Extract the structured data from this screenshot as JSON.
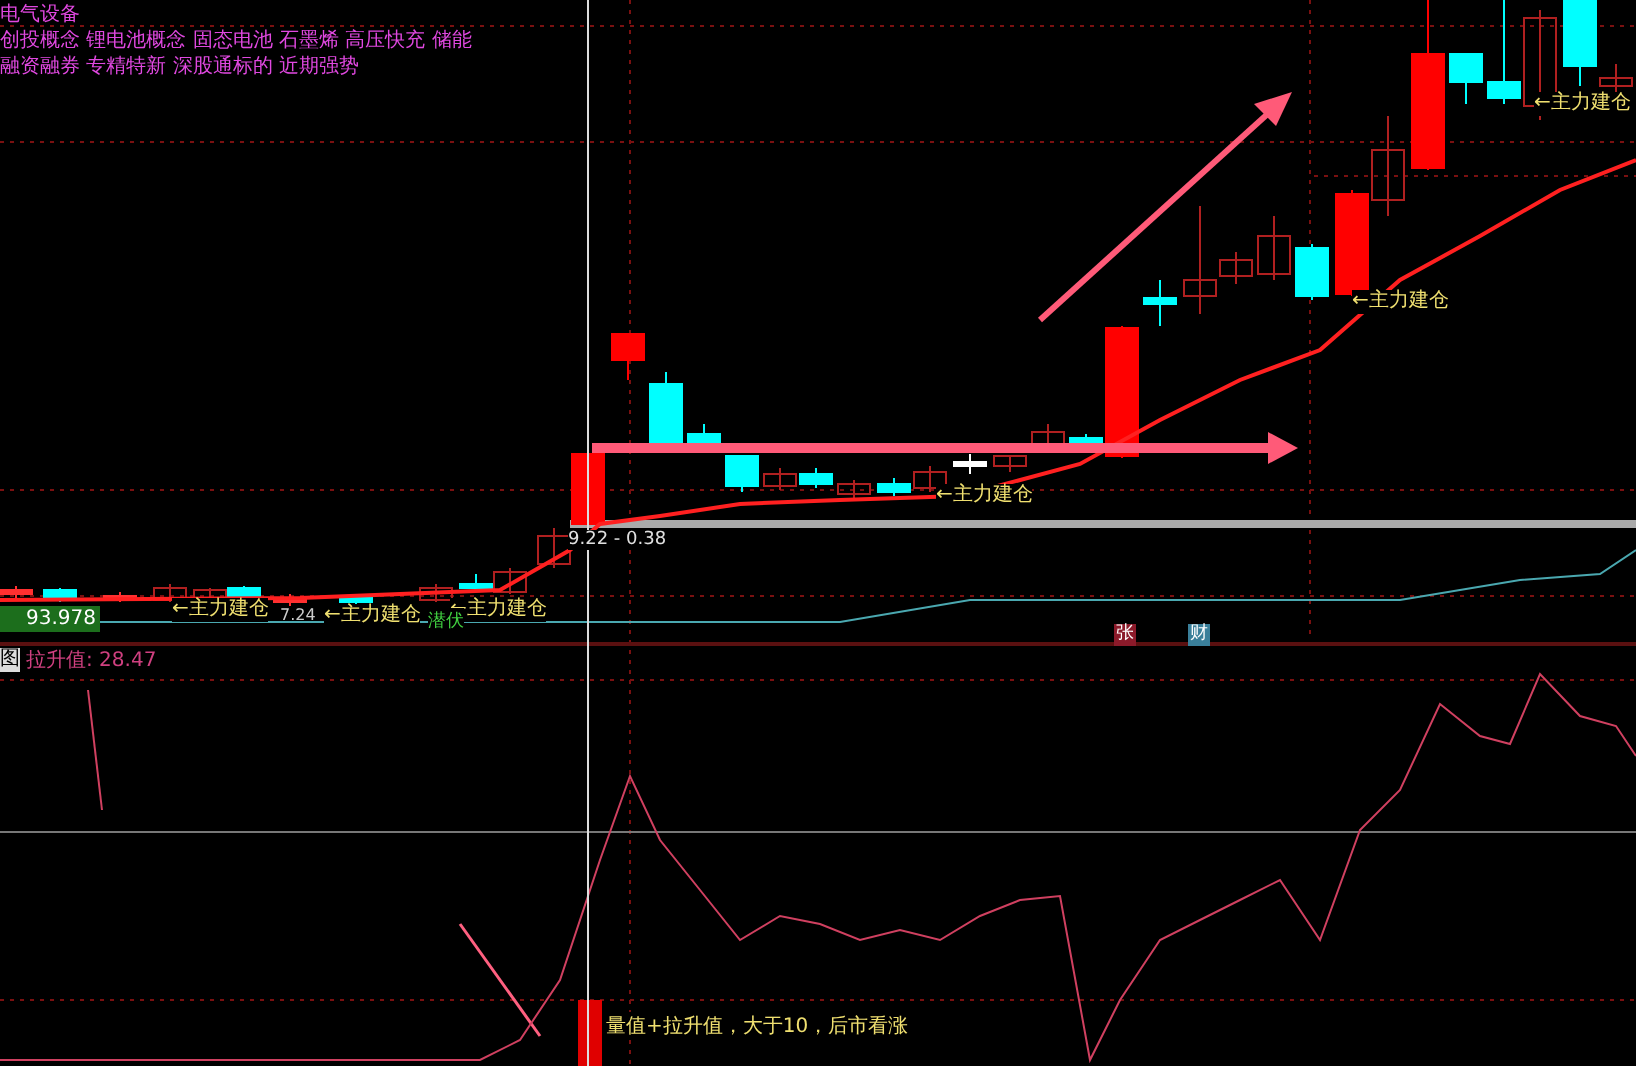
{
  "concept_lines": [
    "电气设备",
    "创投概念 锂电池概念 固态电池 石墨烯 高压快充 储能",
    "融资融券 专精特新 深股通标的 近期强势"
  ],
  "price_box": "93.978",
  "range_label": "9.22 - 0.38",
  "low_price": "7.24",
  "hint_label": "潜伏",
  "annotations": [
    {
      "text": "←主力建仓"
    },
    {
      "text": "←主力建仓"
    },
    {
      "text": "←主力建仓"
    },
    {
      "text": "←主力建仓"
    },
    {
      "text": "←主力建仓"
    },
    {
      "text": "←主力建仓"
    }
  ],
  "event_markers": [
    {
      "text": "张",
      "color": "#8b1a2a"
    },
    {
      "text": "财",
      "color": "#3a7f9a"
    }
  ],
  "indicator": {
    "tag": "图",
    "name": "拉升值: 28.47",
    "signal_text": "量值+拉升值，大于10，后市看涨"
  }
}
